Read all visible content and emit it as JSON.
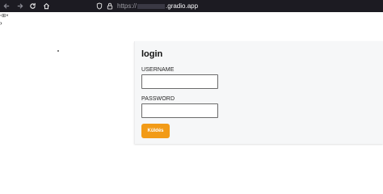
{
  "browser": {
    "url_protocol": "https://",
    "url_domain": ".gradio.app",
    "icons": {
      "back": "arrow-left-icon",
      "forward": "arrow-right-icon",
      "reload": "reload-icon",
      "home": "home-icon",
      "shield": "shield-icon",
      "lock": "lock-icon"
    }
  },
  "page": {
    "top_strip": "▫⊞×",
    "caret": "›",
    "form": {
      "title": "login",
      "username_label": "USERNAME",
      "username_value": "",
      "password_label": "PASSWORD",
      "password_value": "",
      "submit_label": "Küldés"
    }
  },
  "colors": {
    "browser_bar": "#1c1b22",
    "card_background": "#f6f7f8",
    "submit_button": "#f29b17"
  }
}
